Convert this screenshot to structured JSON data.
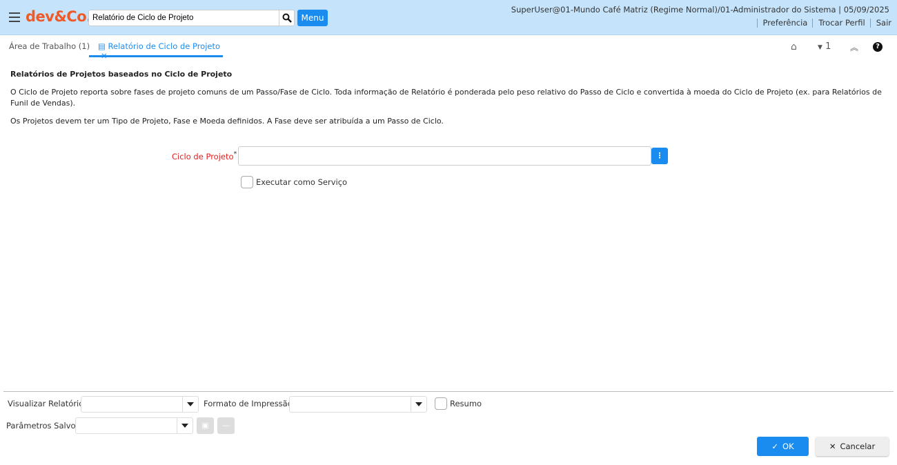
{
  "header": {
    "logo": "dev&Co.",
    "search_value": "Relatório de Ciclo de Projeto",
    "menu_label": "Menu",
    "user_info": "SuperUser@01-Mundo Café Matriz (Regime Normal)/01-Administrador do Sistema | 05/09/2025",
    "links": [
      "Preferência",
      "Trocar Perfil",
      "Sair"
    ]
  },
  "tabs": [
    {
      "label": "Área de Trabalho (1)"
    },
    {
      "label": "Relatório de Ciclo de Projeto"
    }
  ],
  "toolbar": {
    "count": "1"
  },
  "content": {
    "title": "Relatórios de Projetos baseados no Ciclo de Projeto",
    "p1": "O Ciclo de Projeto reporta sobre fases de projeto comuns de um Passo/Fase de Ciclo. Toda informação de Relatório é ponderada pelo peso relativo do Passo de Ciclo e convertida à moeda do Ciclo de Projeto (ex. para Relatórios de Funil de Vendas).",
    "p2": "Os Projetos devem ter um Tipo de Projeto, Fase e Moeda definidos. A Fase deve ser atribuída a um Passo de Ciclo."
  },
  "form": {
    "ciclo_label": "Ciclo de Projeto",
    "required_mark": "*",
    "ciclo_value": "",
    "service_label": "Executar como Serviço"
  },
  "footer": {
    "view_label": "Visualizar Relatório",
    "format_label": "Formato de Impressão",
    "summary_label": "Resumo",
    "saved_label": "Parâmetros Salvos",
    "ok_label": "OK",
    "cancel_label": "Cancelar"
  }
}
